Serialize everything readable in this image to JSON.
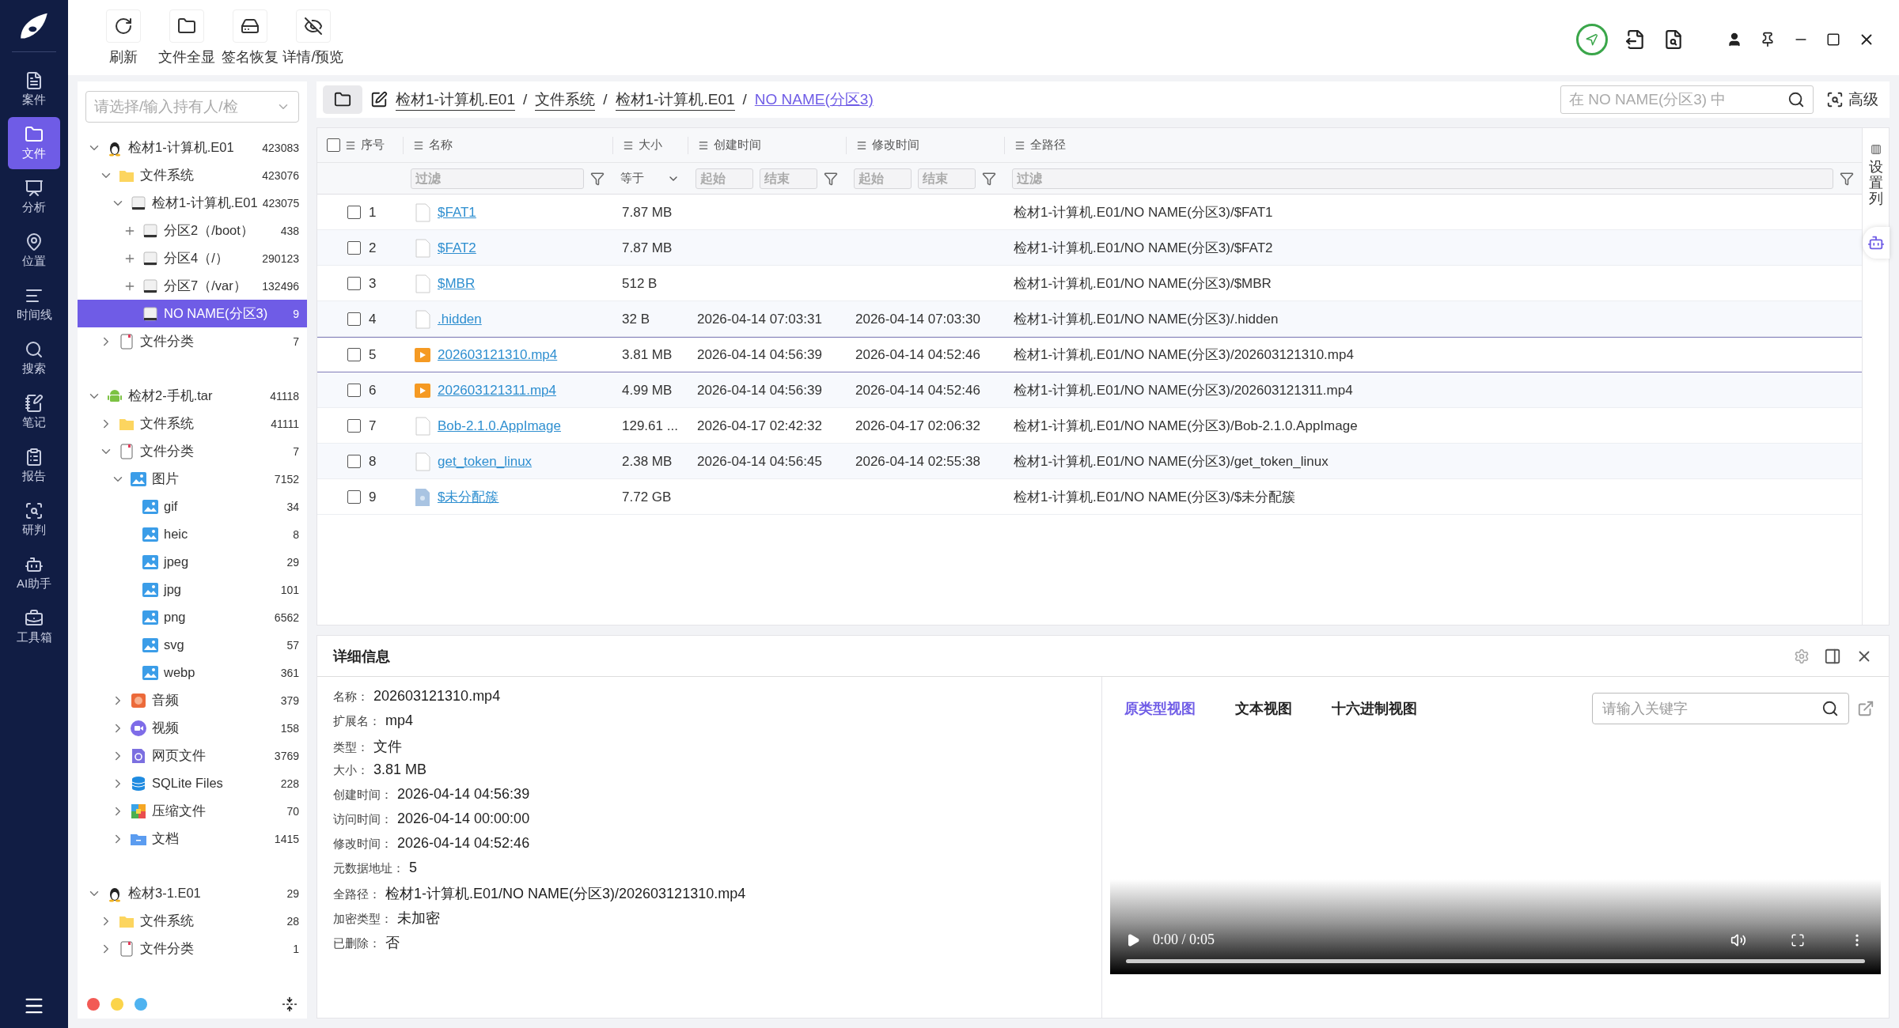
{
  "nav": [
    {
      "label": "案件",
      "selected": false
    },
    {
      "label": "文件",
      "selected": true
    },
    {
      "label": "分析",
      "selected": false
    },
    {
      "label": "位置",
      "selected": false
    },
    {
      "label": "时间线",
      "selected": false
    },
    {
      "label": "搜索",
      "selected": false
    },
    {
      "label": "笔记",
      "selected": false
    },
    {
      "label": "报告",
      "selected": false
    },
    {
      "label": "研判",
      "selected": false
    },
    {
      "label": "AI助手",
      "selected": false
    },
    {
      "label": "工具箱",
      "selected": false
    }
  ],
  "toolbar": [
    "刷新",
    "文件全显",
    "签名恢复",
    "详情/预览"
  ],
  "tree_panel": {
    "placeholder": "请选择/输入持有人/检",
    "tree": [
      {
        "label": "检材1-计算机.E01",
        "count": "423083",
        "kind": "linux",
        "expanded": true,
        "selected": false,
        "children": [
          {
            "label": "文件系统",
            "count": "423076",
            "kind": "folder",
            "expanded": true,
            "selected": false,
            "children": [
              {
                "label": "检材1-计算机.E01",
                "count": "423075",
                "kind": "disk",
                "expanded": true,
                "selected": false,
                "children": [
                  {
                    "label": "分区2（/boot）",
                    "count": "438",
                    "kind": "disk",
                    "lazy": true,
                    "expanded": false,
                    "selected": false
                  },
                  {
                    "label": "分区4（/）",
                    "count": "290123",
                    "kind": "disk",
                    "lazy": true,
                    "expanded": false,
                    "selected": false
                  },
                  {
                    "label": "分区7（/var）",
                    "count": "132496",
                    "kind": "disk",
                    "lazy": true,
                    "expanded": false,
                    "selected": false
                  },
                  {
                    "label": "NO NAME(分区3)",
                    "count": "9",
                    "kind": "disk",
                    "selected": true
                  }
                ]
              }
            ]
          },
          {
            "label": "文件分类",
            "count": "7",
            "kind": "category",
            "expanded": false,
            "selected": false
          }
        ]
      },
      {
        "label": "检材2-手机.tar",
        "count": "41118",
        "kind": "android",
        "expanded": true,
        "selected": false,
        "children": [
          {
            "label": "文件系统",
            "count": "41111",
            "kind": "folder",
            "expanded": false,
            "selected": false
          },
          {
            "label": "文件分类",
            "count": "7",
            "kind": "category",
            "expanded": true,
            "selected": false,
            "children": [
              {
                "label": "图片",
                "count": "7152",
                "kind": "image",
                "expanded": true,
                "selected": false,
                "children": [
                  {
                    "label": "gif",
                    "count": "34",
                    "kind": "image",
                    "selected": false
                  },
                  {
                    "label": "heic",
                    "count": "8",
                    "kind": "image",
                    "selected": false
                  },
                  {
                    "label": "jpeg",
                    "count": "29",
                    "kind": "image",
                    "selected": false
                  },
                  {
                    "label": "jpg",
                    "count": "101",
                    "kind": "image",
                    "selected": false
                  },
                  {
                    "label": "png",
                    "count": "6562",
                    "kind": "image",
                    "selected": false
                  },
                  {
                    "label": "svg",
                    "count": "57",
                    "kind": "image",
                    "selected": false
                  },
                  {
                    "label": "webp",
                    "count": "361",
                    "kind": "image",
                    "selected": false
                  }
                ]
              },
              {
                "label": "音频",
                "count": "379",
                "kind": "audio",
                "expanded": false,
                "selected": false
              },
              {
                "label": "视频",
                "count": "158",
                "kind": "video",
                "expanded": false,
                "selected": false
              },
              {
                "label": "网页文件",
                "count": "3769",
                "kind": "web",
                "expanded": false,
                "selected": false
              },
              {
                "label": "SQLite Files",
                "count": "228",
                "kind": "sqlite",
                "expanded": false,
                "selected": false
              },
              {
                "label": "压缩文件",
                "count": "70",
                "kind": "archive",
                "expanded": false,
                "selected": false
              },
              {
                "label": "文档",
                "count": "1415",
                "kind": "docs",
                "expanded": false,
                "selected": false
              }
            ]
          }
        ]
      },
      {
        "label": "检材3-1.E01",
        "count": "29",
        "kind": "linux",
        "expanded": true,
        "selected": false,
        "children": [
          {
            "label": "文件系统",
            "count": "28",
            "kind": "folder",
            "expanded": false,
            "selected": false
          },
          {
            "label": "文件分类",
            "count": "1",
            "kind": "category",
            "expanded": false,
            "selected": false
          }
        ]
      }
    ],
    "tag_dots": [
      {
        "color": "#f25a55"
      },
      {
        "color": "#fbd44a"
      },
      {
        "color": "#4fb3f0"
      }
    ]
  },
  "breadcrumb": [
    {
      "label": "检材1-计算机.E01",
      "current": false
    },
    {
      "label": "文件系统",
      "current": false
    },
    {
      "label": "检材1-计算机.E01",
      "current": false
    },
    {
      "label": "NO NAME(分区3)",
      "current": true
    }
  ],
  "breadcrumb_separator": "/",
  "search": {
    "placeholder": "在 NO NAME(分区3) 中",
    "advanced": "高级"
  },
  "table": {
    "select_all_checked": false,
    "columns": [
      {
        "label": "序号"
      },
      {
        "label": "名称",
        "filter": {
          "kind": "text",
          "placeholder": "过滤"
        }
      },
      {
        "label": "大小",
        "filter": {
          "kind": "select",
          "value": "等于"
        }
      },
      {
        "label": "创建时间",
        "filter": {
          "kind": "range",
          "fields": [
            {
              "placeholder": "起始"
            },
            {
              "placeholder": "结束"
            }
          ]
        }
      },
      {
        "label": "修改时间",
        "filter": {
          "kind": "range",
          "fields": [
            {
              "placeholder": "起始"
            },
            {
              "placeholder": "结束"
            }
          ]
        }
      },
      {
        "label": "全路径",
        "filter": {
          "kind": "text",
          "placeholder": "过滤"
        }
      }
    ],
    "rows": [
      {
        "no": "1",
        "name": "$FAT1",
        "kind": "file",
        "size": "7.87 MB",
        "created": "",
        "modified": "",
        "path": "检材1-计算机.E01/NO NAME(分区3)/$FAT1",
        "checked": false,
        "selected": false
      },
      {
        "no": "2",
        "name": "$FAT2",
        "kind": "file",
        "size": "7.87 MB",
        "created": "",
        "modified": "",
        "path": "检材1-计算机.E01/NO NAME(分区3)/$FAT2",
        "checked": false,
        "selected": false
      },
      {
        "no": "3",
        "name": "$MBR",
        "kind": "file",
        "size": "512 B",
        "created": "",
        "modified": "",
        "path": "检材1-计算机.E01/NO NAME(分区3)/$MBR",
        "checked": false,
        "selected": false
      },
      {
        "no": "4",
        "name": ".hidden",
        "kind": "file",
        "size": "32 B",
        "created": "2026-04-14 07:03:31",
        "modified": "2026-04-14 07:03:30",
        "path": "检材1-计算机.E01/NO NAME(分区3)/.hidden",
        "checked": false,
        "selected": false
      },
      {
        "no": "5",
        "name": "202603121310.mp4",
        "kind": "video",
        "size": "3.81 MB",
        "created": "2026-04-14 04:56:39",
        "modified": "2026-04-14 04:52:46",
        "path": "检材1-计算机.E01/NO NAME(分区3)/202603121310.mp4",
        "checked": false,
        "selected": true
      },
      {
        "no": "6",
        "name": "202603121311.mp4",
        "kind": "video",
        "size": "4.99 MB",
        "created": "2026-04-14 04:56:39",
        "modified": "2026-04-14 04:52:46",
        "path": "检材1-计算机.E01/NO NAME(分区3)/202603121311.mp4",
        "checked": false,
        "selected": false
      },
      {
        "no": "7",
        "name": "Bob-2.1.0.AppImage",
        "kind": "file",
        "size": "129.61 ...",
        "created": "2026-04-17 02:42:32",
        "modified": "2026-04-17 02:06:32",
        "path": "检材1-计算机.E01/NO NAME(分区3)/Bob-2.1.0.AppImage",
        "checked": false,
        "selected": false
      },
      {
        "no": "8",
        "name": "get_token_linux",
        "kind": "file",
        "size": "2.38 MB",
        "created": "2026-04-14 04:56:45",
        "modified": "2026-04-14 02:55:38",
        "path": "检材1-计算机.E01/NO NAME(分区3)/get_token_linux",
        "checked": false,
        "selected": false
      },
      {
        "no": "9",
        "name": "$未分配簇",
        "kind": "unknown",
        "size": "7.72 GB",
        "created": "",
        "modified": "",
        "path": "检材1-计算机.E01/NO NAME(分区3)/$未分配簇",
        "checked": false,
        "selected": false
      }
    ]
  },
  "column_settings": "设置列",
  "details": {
    "title": "详细信息",
    "fields": [
      {
        "label": "名称：",
        "value": "202603121310.mp4"
      },
      {
        "label": "扩展名：",
        "value": "mp4"
      },
      {
        "label": "类型：",
        "value": "文件"
      },
      {
        "label": "大小：",
        "value": "3.81 MB"
      },
      {
        "label": "创建时间：",
        "value": "2026-04-14 04:56:39"
      },
      {
        "label": "访问时间：",
        "value": "2026-04-14 00:00:00"
      },
      {
        "label": "修改时间：",
        "value": "2026-04-14 04:52:46"
      },
      {
        "label": "元数据地址：",
        "value": "5"
      },
      {
        "label": "全路径：",
        "value": "检材1-计算机.E01/NO NAME(分区3)/202603121310.mp4"
      },
      {
        "label": "加密类型：",
        "value": "未加密"
      },
      {
        "label": "已删除：",
        "value": "否"
      }
    ]
  },
  "preview": {
    "tabs": [
      {
        "label": "原类型视图",
        "selected": true
      },
      {
        "label": "文本视图",
        "selected": false
      },
      {
        "label": "十六进制视图",
        "selected": false
      }
    ],
    "search_placeholder": "请输入关键字",
    "player": {
      "time": "0:00 / 0:05"
    }
  }
}
